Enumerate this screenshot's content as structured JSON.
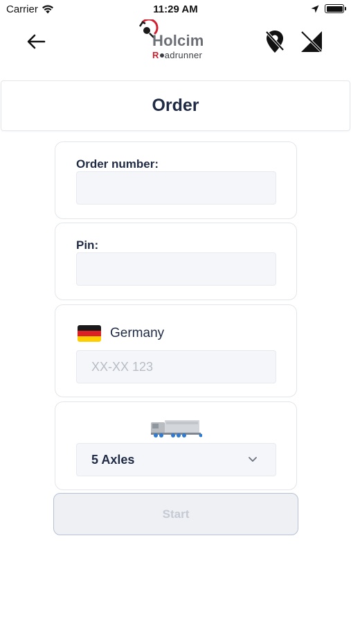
{
  "status_bar": {
    "carrier": "Carrier",
    "time": "11:29 AM"
  },
  "nav": {
    "logo_word": "Holcim",
    "logo_sub_first": "R",
    "logo_sub_rest": "adrunner"
  },
  "page": {
    "title": "Order"
  },
  "order_number": {
    "label": "Order number:",
    "value": ""
  },
  "pin": {
    "label": "Pin:",
    "value": ""
  },
  "plate": {
    "country": "Germany",
    "placeholder": "XX-XX 123"
  },
  "vehicle": {
    "selected": "5 Axles"
  },
  "start_button": {
    "label": "Start"
  },
  "colors": {
    "brand_red": "#d2202f",
    "text_dark": "#1f2a44",
    "field_bg": "#f4f6f9",
    "disabled_text": "#c5cad4"
  },
  "icons": [
    "wifi-icon",
    "location-arrow-icon",
    "battery-icon",
    "back-arrow-icon",
    "location-off-icon",
    "no-signal-icon",
    "germany-flag-icon",
    "truck-icon",
    "chevron-down-icon"
  ]
}
